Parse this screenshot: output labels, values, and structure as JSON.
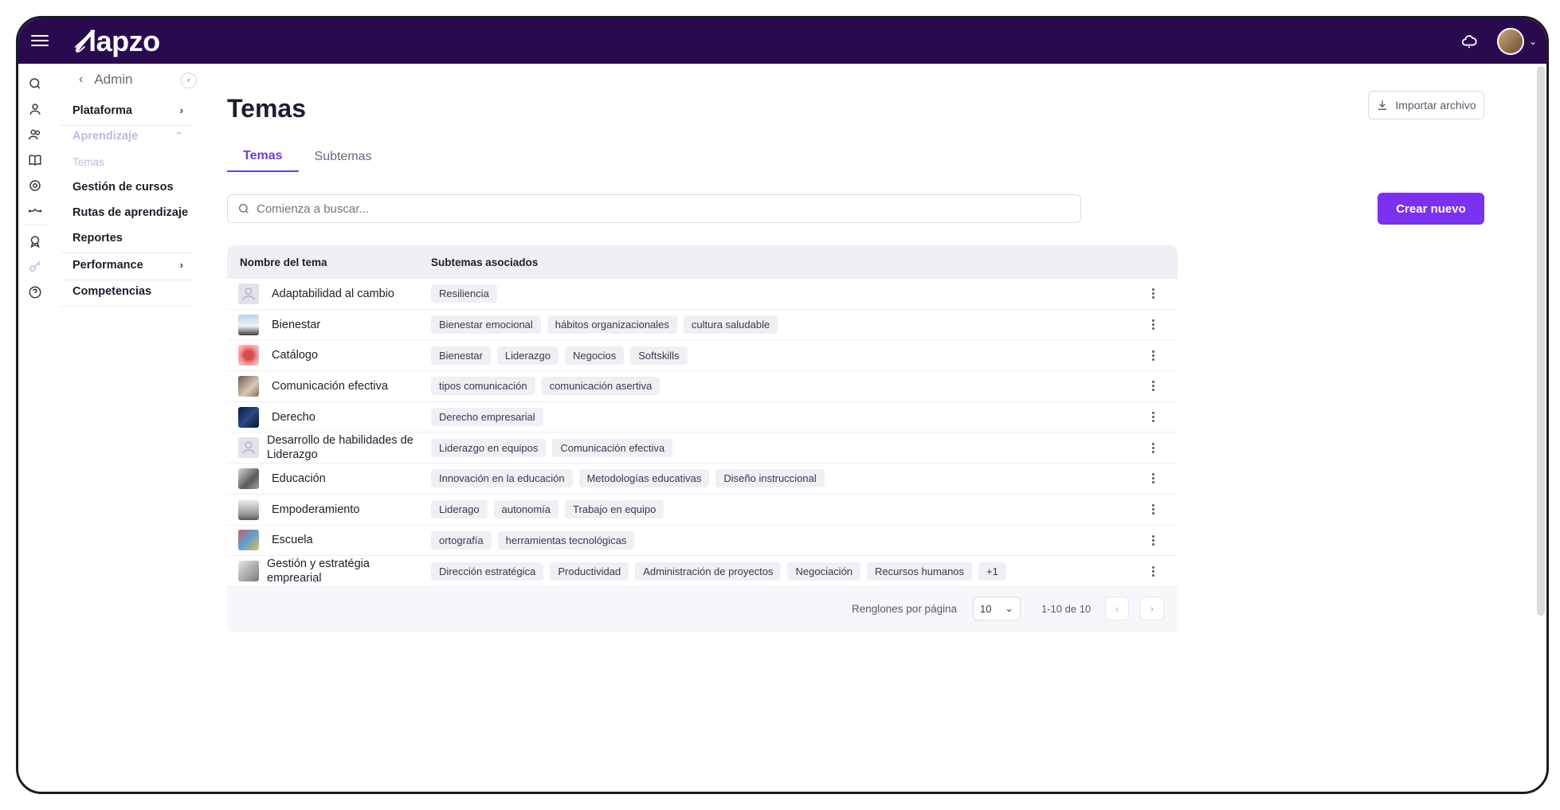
{
  "app": {
    "brand": "lapzo"
  },
  "topbar": {
    "notification_icon": "cloud-bell-icon",
    "avatar": "user-avatar"
  },
  "sidebar": {
    "back_label": "Admin",
    "items": [
      {
        "label": "Plataforma",
        "has_chevron": true
      },
      {
        "label": "Aprendizaje",
        "expanded": true
      },
      {
        "label": "Temas",
        "active": true
      },
      {
        "label": "Gestión de cursos"
      },
      {
        "label": "Rutas de aprendizaje"
      },
      {
        "label": "Reportes"
      },
      {
        "label": "Performance",
        "has_chevron": true
      },
      {
        "label": "Competencias"
      }
    ]
  },
  "page": {
    "title": "Temas",
    "import_label": "Importar archivo",
    "tabs": [
      {
        "label": "Temas",
        "active": true
      },
      {
        "label": "Subtemas"
      }
    ],
    "search_placeholder": "Comienza a buscar...",
    "create_label": "Crear nuevo"
  },
  "table": {
    "headers": {
      "name": "Nombre del tema",
      "subtopics": "Subtemas asociados"
    },
    "rows": [
      {
        "name": "Adaptabilidad al cambio",
        "subtopics": [
          "Resiliencia"
        ]
      },
      {
        "name": "Bienestar",
        "subtopics": [
          "Bienestar emocional",
          "hábitos organizacionales",
          "cultura saludable"
        ]
      },
      {
        "name": "Catálogo",
        "subtopics": [
          "Bienestar",
          "Liderazgo",
          "Negocios",
          "Softskills"
        ]
      },
      {
        "name": "Comunicación efectiva",
        "subtopics": [
          "tipos comunicación",
          "comunicación asertiva"
        ]
      },
      {
        "name": "Derecho",
        "subtopics": [
          "Derecho empresarial"
        ]
      },
      {
        "name": "Desarrollo de habilidades de Liderazgo",
        "subtopics": [
          "Liderazgo en equipos",
          "Comunicación efectiva"
        ]
      },
      {
        "name": "Educación",
        "subtopics": [
          "Innovación en la educación",
          "Metodologías educativas",
          "Diseño instruccional"
        ]
      },
      {
        "name": "Empoderamiento",
        "subtopics": [
          "Liderago",
          "autonomía",
          "Trabajo en equipo"
        ]
      },
      {
        "name": "Escuela",
        "subtopics": [
          "ortografía",
          "herramientas tecnológicas"
        ]
      },
      {
        "name": "Gestión y estratégia emprearial",
        "subtopics": [
          "Dirección estratégica",
          "Productividad",
          "Administración de proyectos",
          "Negociación",
          "Recursos humanos",
          "+1"
        ]
      }
    ]
  },
  "pagination": {
    "rows_label": "Renglones por página",
    "rows_value": "10",
    "range": "1-10 de 10"
  },
  "colors": {
    "brand": "#2a0a4f",
    "accent": "#7a31f0",
    "tab_active": "#6c3fd9"
  }
}
